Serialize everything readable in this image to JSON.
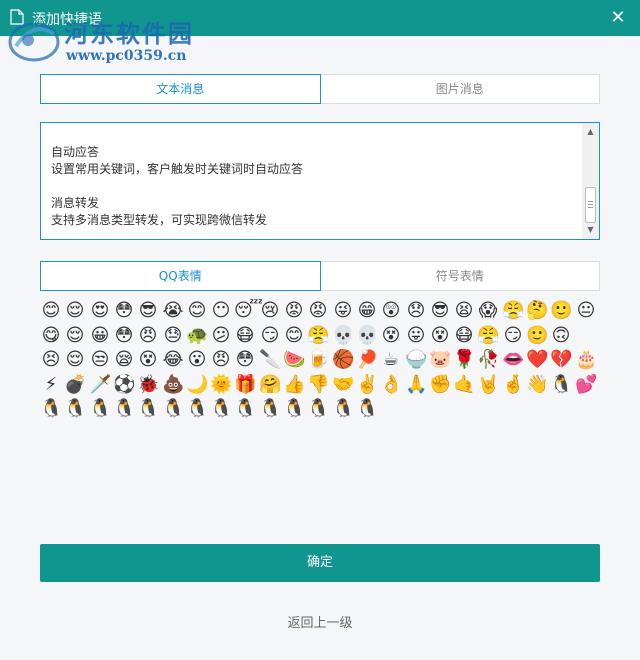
{
  "window": {
    "title": "添加快捷语",
    "close_glyph": "✕"
  },
  "watermark": {
    "title": "河东软件园",
    "url": "www.pc0359.cn"
  },
  "message_tabs": [
    {
      "label": "文本消息",
      "active": true
    },
    {
      "label": "图片消息",
      "active": false
    }
  ],
  "message_box": {
    "lines": [
      "自动应答",
      "设置常用关键词，客户触发时关键词时自动应答",
      "",
      "消息转发",
      "支持多消息类型转发，可实现跨微信转发"
    ]
  },
  "emoji_tabs": [
    {
      "label": "QQ表情",
      "active": true
    },
    {
      "label": "符号表情",
      "active": false
    }
  ],
  "emoji_rows": [
    [
      "😊",
      "😌",
      "😍",
      "😳",
      "😎",
      "😭",
      "😊",
      "😶",
      "😴",
      "😢",
      "😡",
      "😡",
      "😜",
      "😁",
      "😲",
      "😞",
      "😎",
      "😫",
      "😱",
      "😤",
      "🤔",
      "🙂",
      "😐"
    ],
    [
      "😋",
      "😌",
      "😀",
      "😳",
      "😠",
      "😓",
      "🐢",
      "😕",
      "😷",
      "😏",
      "😊",
      "😤",
      "💀",
      "💀",
      "😵",
      "😛",
      "😵",
      "😷",
      "😤",
      "😏",
      "🙂",
      "🙃"
    ],
    [
      "😣",
      "😌",
      "😒",
      "😪",
      "😵",
      "😂",
      "😮",
      "😠",
      "😳",
      "🔪",
      "🍉",
      "🍺",
      "🏀",
      "🏓",
      "☕",
      "🍚",
      "🐷",
      "🌹",
      "🥀",
      "👄",
      "❤️",
      "💔",
      "🎂"
    ],
    [
      "⚡",
      "💣",
      "🗡️",
      "⚽",
      "🐞",
      "💩",
      "🌙",
      "🌞",
      "🎁",
      "🤗",
      "👍",
      "👎",
      "🤝",
      "✌️",
      "👌",
      "🙏",
      "✊",
      "🤙",
      "🤘",
      "🤞",
      "👋",
      "🐧",
      "💕"
    ],
    [
      "🐧",
      "🐧",
      "🐧",
      "🐧",
      "🐧",
      "🐧",
      "🐧",
      "🐧",
      "🐧",
      "🐧",
      "🐧",
      "🐧",
      "🐧",
      "🐧"
    ]
  ],
  "confirm_label": "确定",
  "back_label": "返回上一级"
}
